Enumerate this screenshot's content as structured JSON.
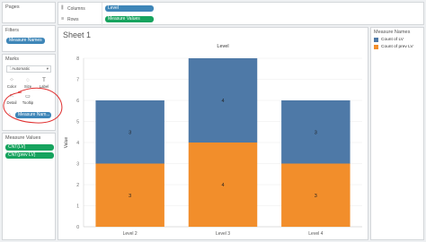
{
  "sidebar": {
    "pages": {
      "title": "Pages"
    },
    "filters": {
      "title": "Filters",
      "pill": "Measure Names"
    },
    "marks": {
      "title": "Marks",
      "type": "Automatic",
      "buttons": [
        {
          "icon": "color-icon",
          "label": "Color",
          "glyph": "⁘"
        },
        {
          "icon": "size-icon",
          "label": "Size",
          "glyph": "◌"
        },
        {
          "icon": "label-icon",
          "label": "Label",
          "glyph": "T"
        },
        {
          "icon": "detail-icon",
          "label": "Detail",
          "glyph": "⁙"
        },
        {
          "icon": "tooltip-icon",
          "label": "Tooltip",
          "glyph": "▭"
        }
      ],
      "pill": "Measure Nam..."
    },
    "measure_values": {
      "title": "Measure Values",
      "pills": [
        "CNT(LV)",
        "CNT(prev LV)"
      ]
    }
  },
  "shelves": {
    "columns": {
      "label": "Columns",
      "pill": "Level"
    },
    "rows": {
      "label": "Rows",
      "pill": "Measure Values"
    }
  },
  "sheet": {
    "title": "Sheet 1"
  },
  "legend": {
    "title": "Measure Names",
    "items": [
      {
        "label": "Count of LV",
        "color": "#4e79a7"
      },
      {
        "label": "Count of prev LV",
        "color": "#f28e2b"
      }
    ]
  },
  "annotation": {
    "color": "#e03030"
  },
  "chart_data": {
    "type": "bar",
    "stacked": true,
    "title": "Level",
    "xlabel": "",
    "ylabel": "Value",
    "categories": [
      "Level 2",
      "Level 3",
      "Level 4"
    ],
    "ylim": [
      0,
      8
    ],
    "yticks": [
      0,
      1,
      2,
      3,
      4,
      5,
      6,
      7,
      8
    ],
    "series": [
      {
        "name": "Count of prev LV",
        "color": "#f28e2b",
        "values": [
          3,
          4,
          3
        ]
      },
      {
        "name": "Count of LV",
        "color": "#4e79a7",
        "values": [
          3,
          4,
          3
        ]
      }
    ],
    "grid": true,
    "legend_position": "right"
  }
}
